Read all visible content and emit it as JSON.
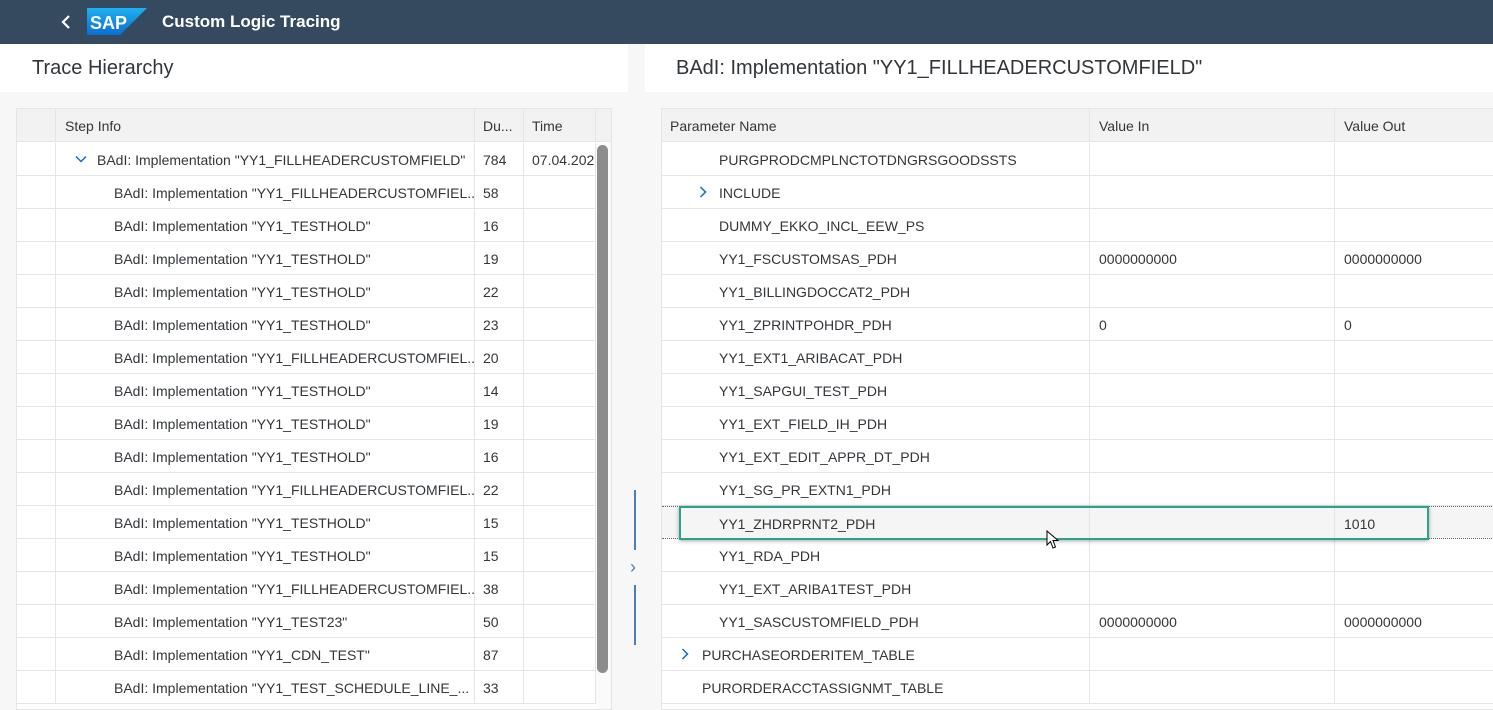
{
  "shell": {
    "app_title": "Custom Logic Tracing",
    "logo_text": "SAP"
  },
  "left": {
    "title": "Trace Hierarchy",
    "columns": [
      "Step Info",
      "Du...",
      "Time"
    ],
    "rows": [
      {
        "step": "BAdI: Implementation \"YY1_FILLHEADERCUSTOMFIELD\"",
        "duration": "784",
        "time": "07.04.202"
      },
      {
        "step": "BAdI: Implementation \"YY1_FILLHEADERCUSTOMFIEL...",
        "duration": "58",
        "time": ""
      },
      {
        "step": "BAdI: Implementation \"YY1_TESTHOLD\"",
        "duration": "16",
        "time": ""
      },
      {
        "step": "BAdI: Implementation \"YY1_TESTHOLD\"",
        "duration": "19",
        "time": ""
      },
      {
        "step": "BAdI: Implementation \"YY1_TESTHOLD\"",
        "duration": "22",
        "time": ""
      },
      {
        "step": "BAdI: Implementation \"YY1_TESTHOLD\"",
        "duration": "23",
        "time": ""
      },
      {
        "step": "BAdI: Implementation \"YY1_FILLHEADERCUSTOMFIEL...",
        "duration": "20",
        "time": ""
      },
      {
        "step": "BAdI: Implementation \"YY1_TESTHOLD\"",
        "duration": "14",
        "time": ""
      },
      {
        "step": "BAdI: Implementation \"YY1_TESTHOLD\"",
        "duration": "19",
        "time": ""
      },
      {
        "step": "BAdI: Implementation \"YY1_TESTHOLD\"",
        "duration": "16",
        "time": ""
      },
      {
        "step": "BAdI: Implementation \"YY1_FILLHEADERCUSTOMFIEL...",
        "duration": "22",
        "time": ""
      },
      {
        "step": "BAdI: Implementation \"YY1_TESTHOLD\"",
        "duration": "15",
        "time": ""
      },
      {
        "step": "BAdI: Implementation \"YY1_TESTHOLD\"",
        "duration": "15",
        "time": ""
      },
      {
        "step": "BAdI: Implementation \"YY1_FILLHEADERCUSTOMFIEL...",
        "duration": "38",
        "time": ""
      },
      {
        "step": "BAdI: Implementation \"YY1_TEST23\"",
        "duration": "50",
        "time": ""
      },
      {
        "step": "BAdI: Implementation \"YY1_CDN_TEST\"",
        "duration": "87",
        "time": ""
      },
      {
        "step": "BAdI: Implementation \"YY1_TEST_SCHEDULE_LINE_...",
        "duration": "33",
        "time": ""
      }
    ]
  },
  "right": {
    "title": "BAdI: Implementation \"YY1_FILLHEADERCUSTOMFIELD\"",
    "columns": [
      "Parameter Name",
      "Value In",
      "Value Out"
    ],
    "rows": [
      {
        "name": "PURGPRODCMPLNCTOTDNGRSGOODSSTS",
        "in": "",
        "out": ""
      },
      {
        "name": "INCLUDE",
        "in": "",
        "out": ""
      },
      {
        "name": "DUMMY_EKKO_INCL_EEW_PS",
        "in": "",
        "out": ""
      },
      {
        "name": "YY1_FSCUSTOMSAS_PDH",
        "in": "0000000000",
        "out": "0000000000"
      },
      {
        "name": "YY1_BILLINGDOCCAT2_PDH",
        "in": "",
        "out": ""
      },
      {
        "name": "YY1_ZPRINTPOHDR_PDH",
        "in": "0",
        "out": "0"
      },
      {
        "name": "YY1_EXT1_ARIBACAT_PDH",
        "in": "",
        "out": ""
      },
      {
        "name": "YY1_SAPGUI_TEST_PDH",
        "in": "",
        "out": ""
      },
      {
        "name": "YY1_EXT_FIELD_IH_PDH",
        "in": "",
        "out": ""
      },
      {
        "name": "YY1_EXT_EDIT_APPR_DT_PDH",
        "in": "",
        "out": ""
      },
      {
        "name": "YY1_SG_PR_EXTN1_PDH",
        "in": "",
        "out": ""
      },
      {
        "name": "YY1_ZHDRPRNT2_PDH",
        "in": "",
        "out": "1010"
      },
      {
        "name": "YY1_RDA_PDH",
        "in": "",
        "out": ""
      },
      {
        "name": "YY1_EXT_ARIBA1TEST_PDH",
        "in": "",
        "out": ""
      },
      {
        "name": "YY1_SASCUSTOMFIELD_PDH",
        "in": "0000000000",
        "out": "0000000000"
      },
      {
        "name": "PURCHASEORDERITEM_TABLE",
        "in": "",
        "out": ""
      },
      {
        "name": "PURORDERACCTASSIGNMT_TABLE",
        "in": "",
        "out": ""
      }
    ]
  },
  "colors": {
    "shell": "#354a5f",
    "highlight": "#2aa38a",
    "accent": "#0a6ed1"
  }
}
